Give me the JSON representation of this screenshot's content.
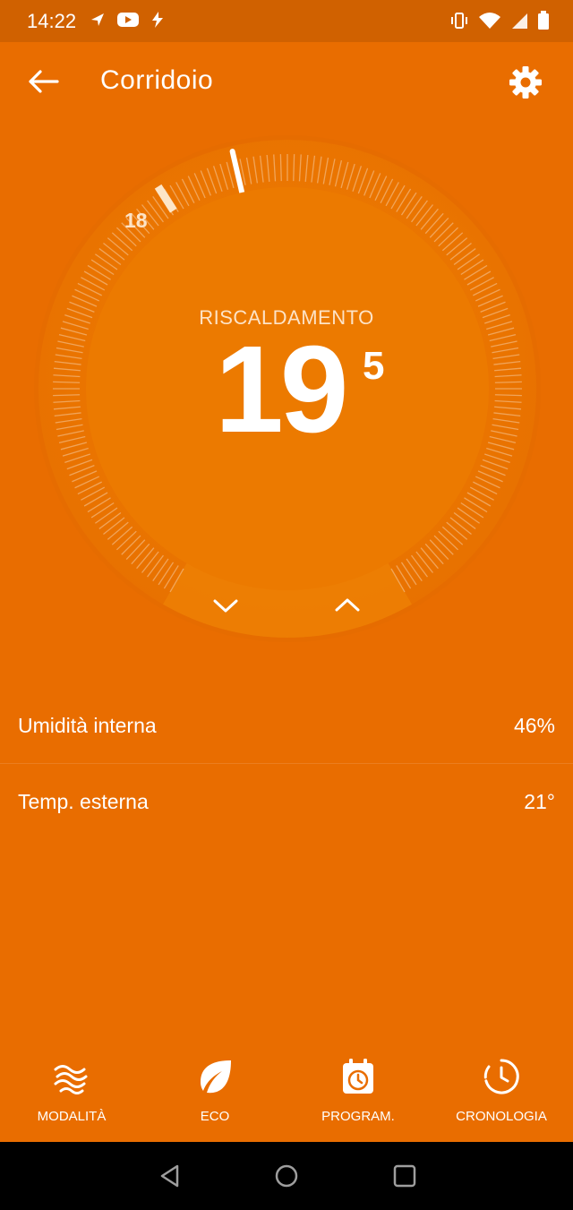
{
  "status_bar": {
    "time": "14:22",
    "left_icons": [
      "navigation-icon",
      "youtube-icon",
      "flash-icon"
    ],
    "right_icons": [
      "vibrate-icon",
      "wifi-icon",
      "signal-icon",
      "battery-icon"
    ]
  },
  "app_bar": {
    "title": "Corridoio",
    "back_icon": "arrow-left-icon",
    "settings_icon": "gear-icon"
  },
  "thermostat": {
    "mode": "RISCALDAMENTO",
    "target_integer": "19",
    "target_decimal": "5",
    "current_marker_label": "18",
    "target_value": 19.5,
    "current_value": 18
  },
  "info": [
    {
      "label": "Umidità interna",
      "value": "46%"
    },
    {
      "label": "Temp. esterna",
      "value": "21°"
    }
  ],
  "bottom_nav": [
    {
      "label": "MODALITÀ",
      "icon": "waves-icon"
    },
    {
      "label": "ECO",
      "icon": "leaf-icon"
    },
    {
      "label": "PROGRAM.",
      "icon": "calendar-clock-icon"
    },
    {
      "label": "CRONOLOGIA",
      "icon": "history-icon"
    }
  ],
  "colors": {
    "background": "#e96d00",
    "status_bar": "#d06100",
    "dial": "#ec7a00",
    "text": "#ffffff"
  }
}
